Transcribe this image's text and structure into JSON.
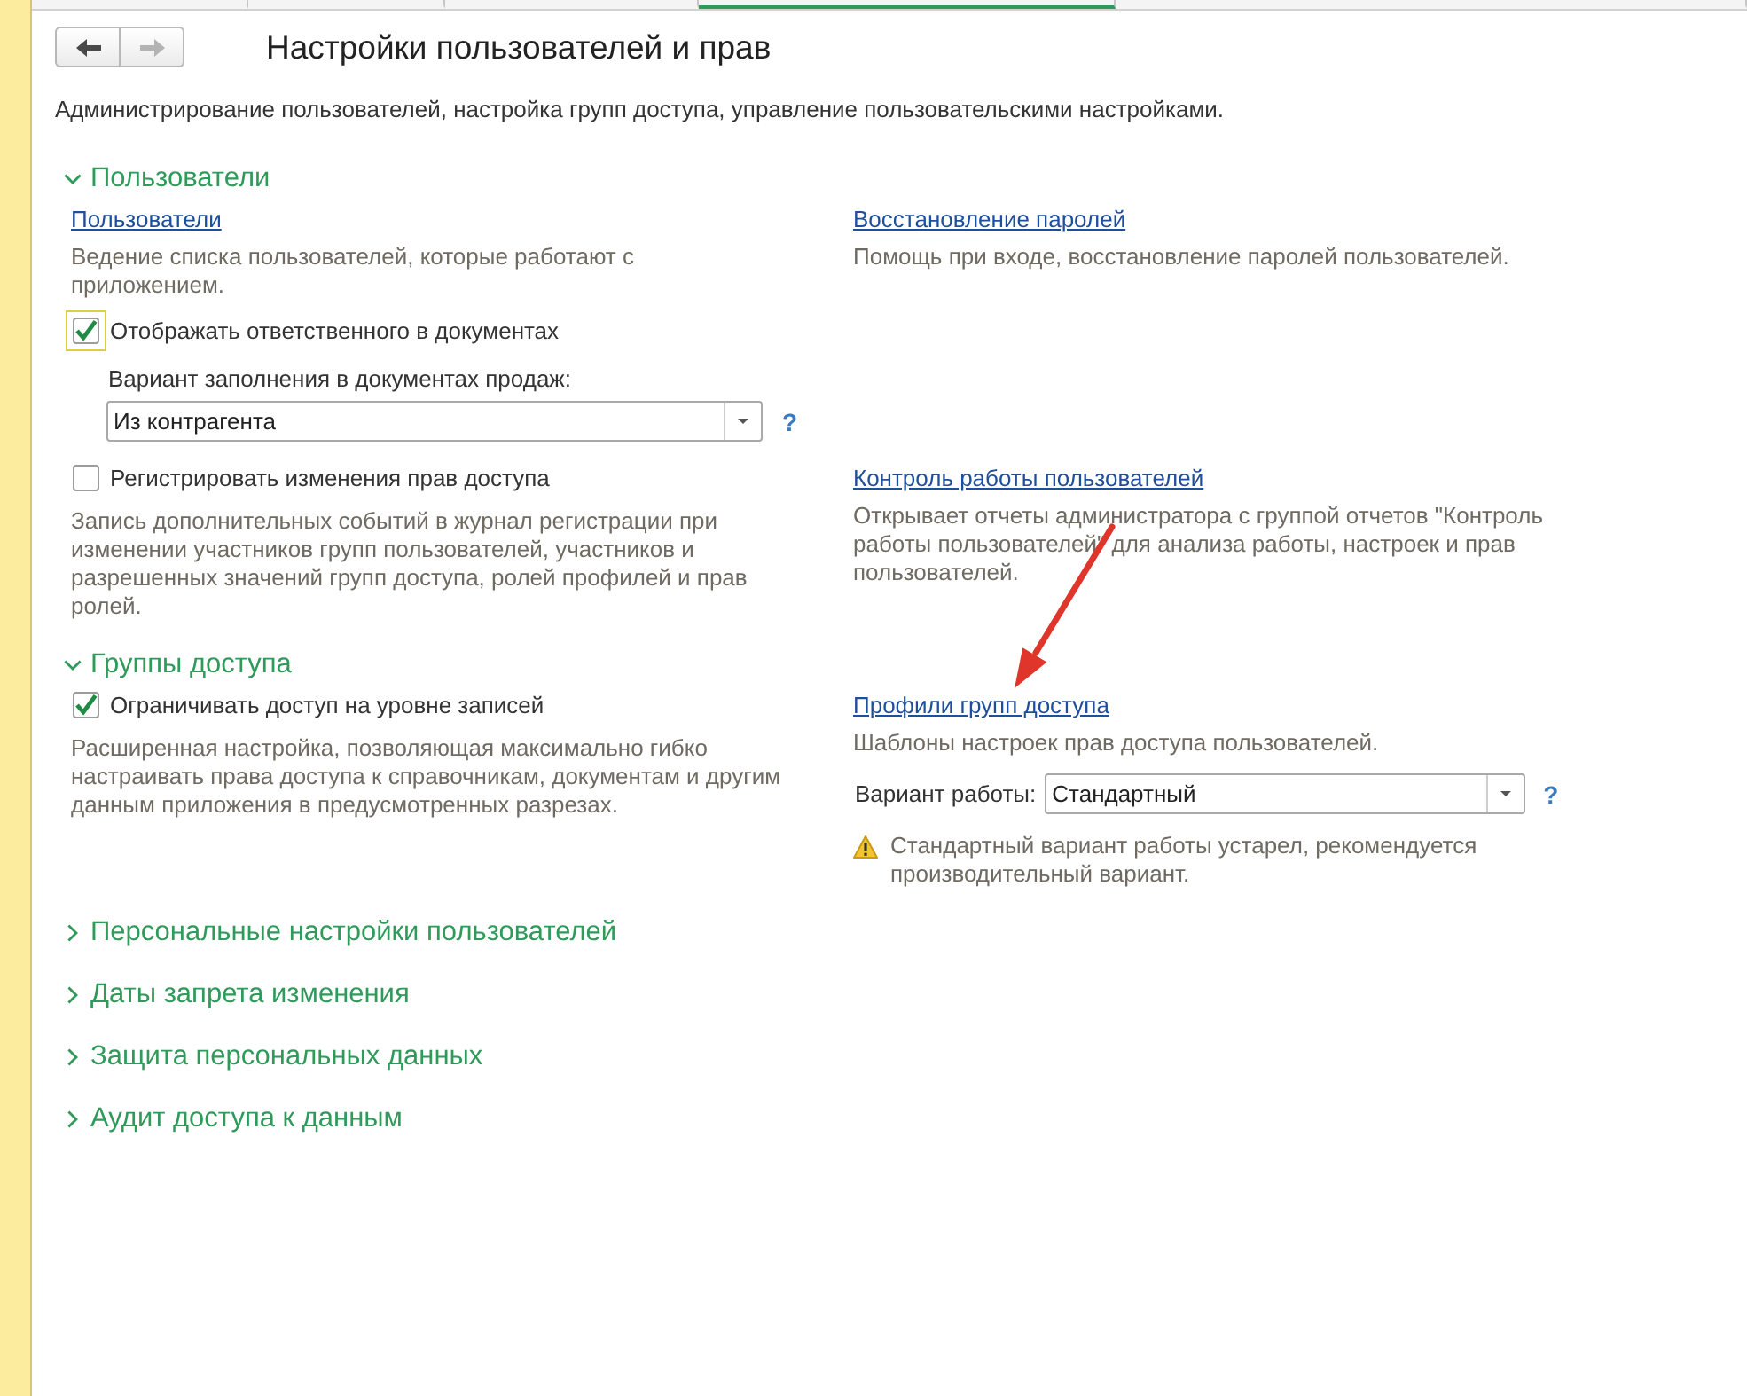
{
  "top_tabs": [
    {
      "selected": false
    },
    {
      "selected": false
    },
    {
      "selected": false
    },
    {
      "selected": true
    },
    {
      "selected": false
    }
  ],
  "nav_buttons": [
    {
      "kind": "back",
      "disabled": false
    },
    {
      "kind": "forward",
      "disabled": true
    }
  ],
  "title": "Настройки пользователей и прав",
  "description": "Администрирование пользователей, настройка групп доступа, управление пользовательскими настройками.",
  "sections": [
    {
      "title": "Пользователи",
      "expanded": true,
      "rows": [
        {
          "left": [
            {
              "kind": "link",
              "text": "Пользователи"
            },
            {
              "kind": "note",
              "text": "Ведение списка пользователей, которые работают с\nприложением."
            },
            {
              "kind": "checkbox",
              "label": "Отображать ответственного в документах",
              "checked": true,
              "focused": true
            },
            {
              "kind": "field",
              "label": "Вариант заполнения в документах продаж:",
              "value": "Из контрагента",
              "help": "?"
            }
          ],
          "right": [
            {
              "kind": "link",
              "text": "Восстановление паролей"
            },
            {
              "kind": "note",
              "text": "Помощь при входе, восстановление паролей пользователей."
            }
          ]
        },
        {
          "left": [
            {
              "kind": "checkbox",
              "label": "Регистрировать изменения прав доступа",
              "checked": false,
              "focused": false
            },
            {
              "kind": "note",
              "text": "Запись дополнительных событий в журнал регистрации при\nизменении участников групп пользователей, участников и\nразрешенных значений групп доступа, ролей профилей и прав\nролей."
            }
          ],
          "right": [
            {
              "kind": "link",
              "text": "Контроль работы пользователей"
            },
            {
              "kind": "note",
              "text": "Открывает отчеты администратора с группой отчетов \"Контроль\nработы пользователей\" для анализа работы, настроек и прав\nпользователей."
            }
          ]
        }
      ]
    },
    {
      "title": "Группы доступа",
      "expanded": true,
      "rows": [
        {
          "left": [
            {
              "kind": "checkbox",
              "label": "Ограничивать доступ на уровне записей",
              "checked": true,
              "focused": false
            },
            {
              "kind": "note",
              "text": "Расширенная настройка, позволяющая максимально гибко\nнастраивать права доступа к справочникам, документам и другим\nданным приложения в предусмотренных разрезах."
            }
          ],
          "right": [
            {
              "kind": "link",
              "text": "Профили групп доступа"
            },
            {
              "kind": "note",
              "text": "Шаблоны настроек прав доступа пользователей."
            },
            {
              "kind": "inline_field",
              "label": "Вариант работы:",
              "value": "Стандартный",
              "help": "?"
            },
            {
              "kind": "warning",
              "text": "Стандартный вариант работы устарел, рекомендуется\nпроизводительный вариант."
            }
          ]
        }
      ]
    },
    {
      "title": "Персональные настройки пользователей",
      "expanded": false
    },
    {
      "title": "Даты запрета изменения",
      "expanded": false
    },
    {
      "title": "Защита персональных данных",
      "expanded": false
    },
    {
      "title": "Аудит доступа к данным",
      "expanded": false
    }
  ]
}
